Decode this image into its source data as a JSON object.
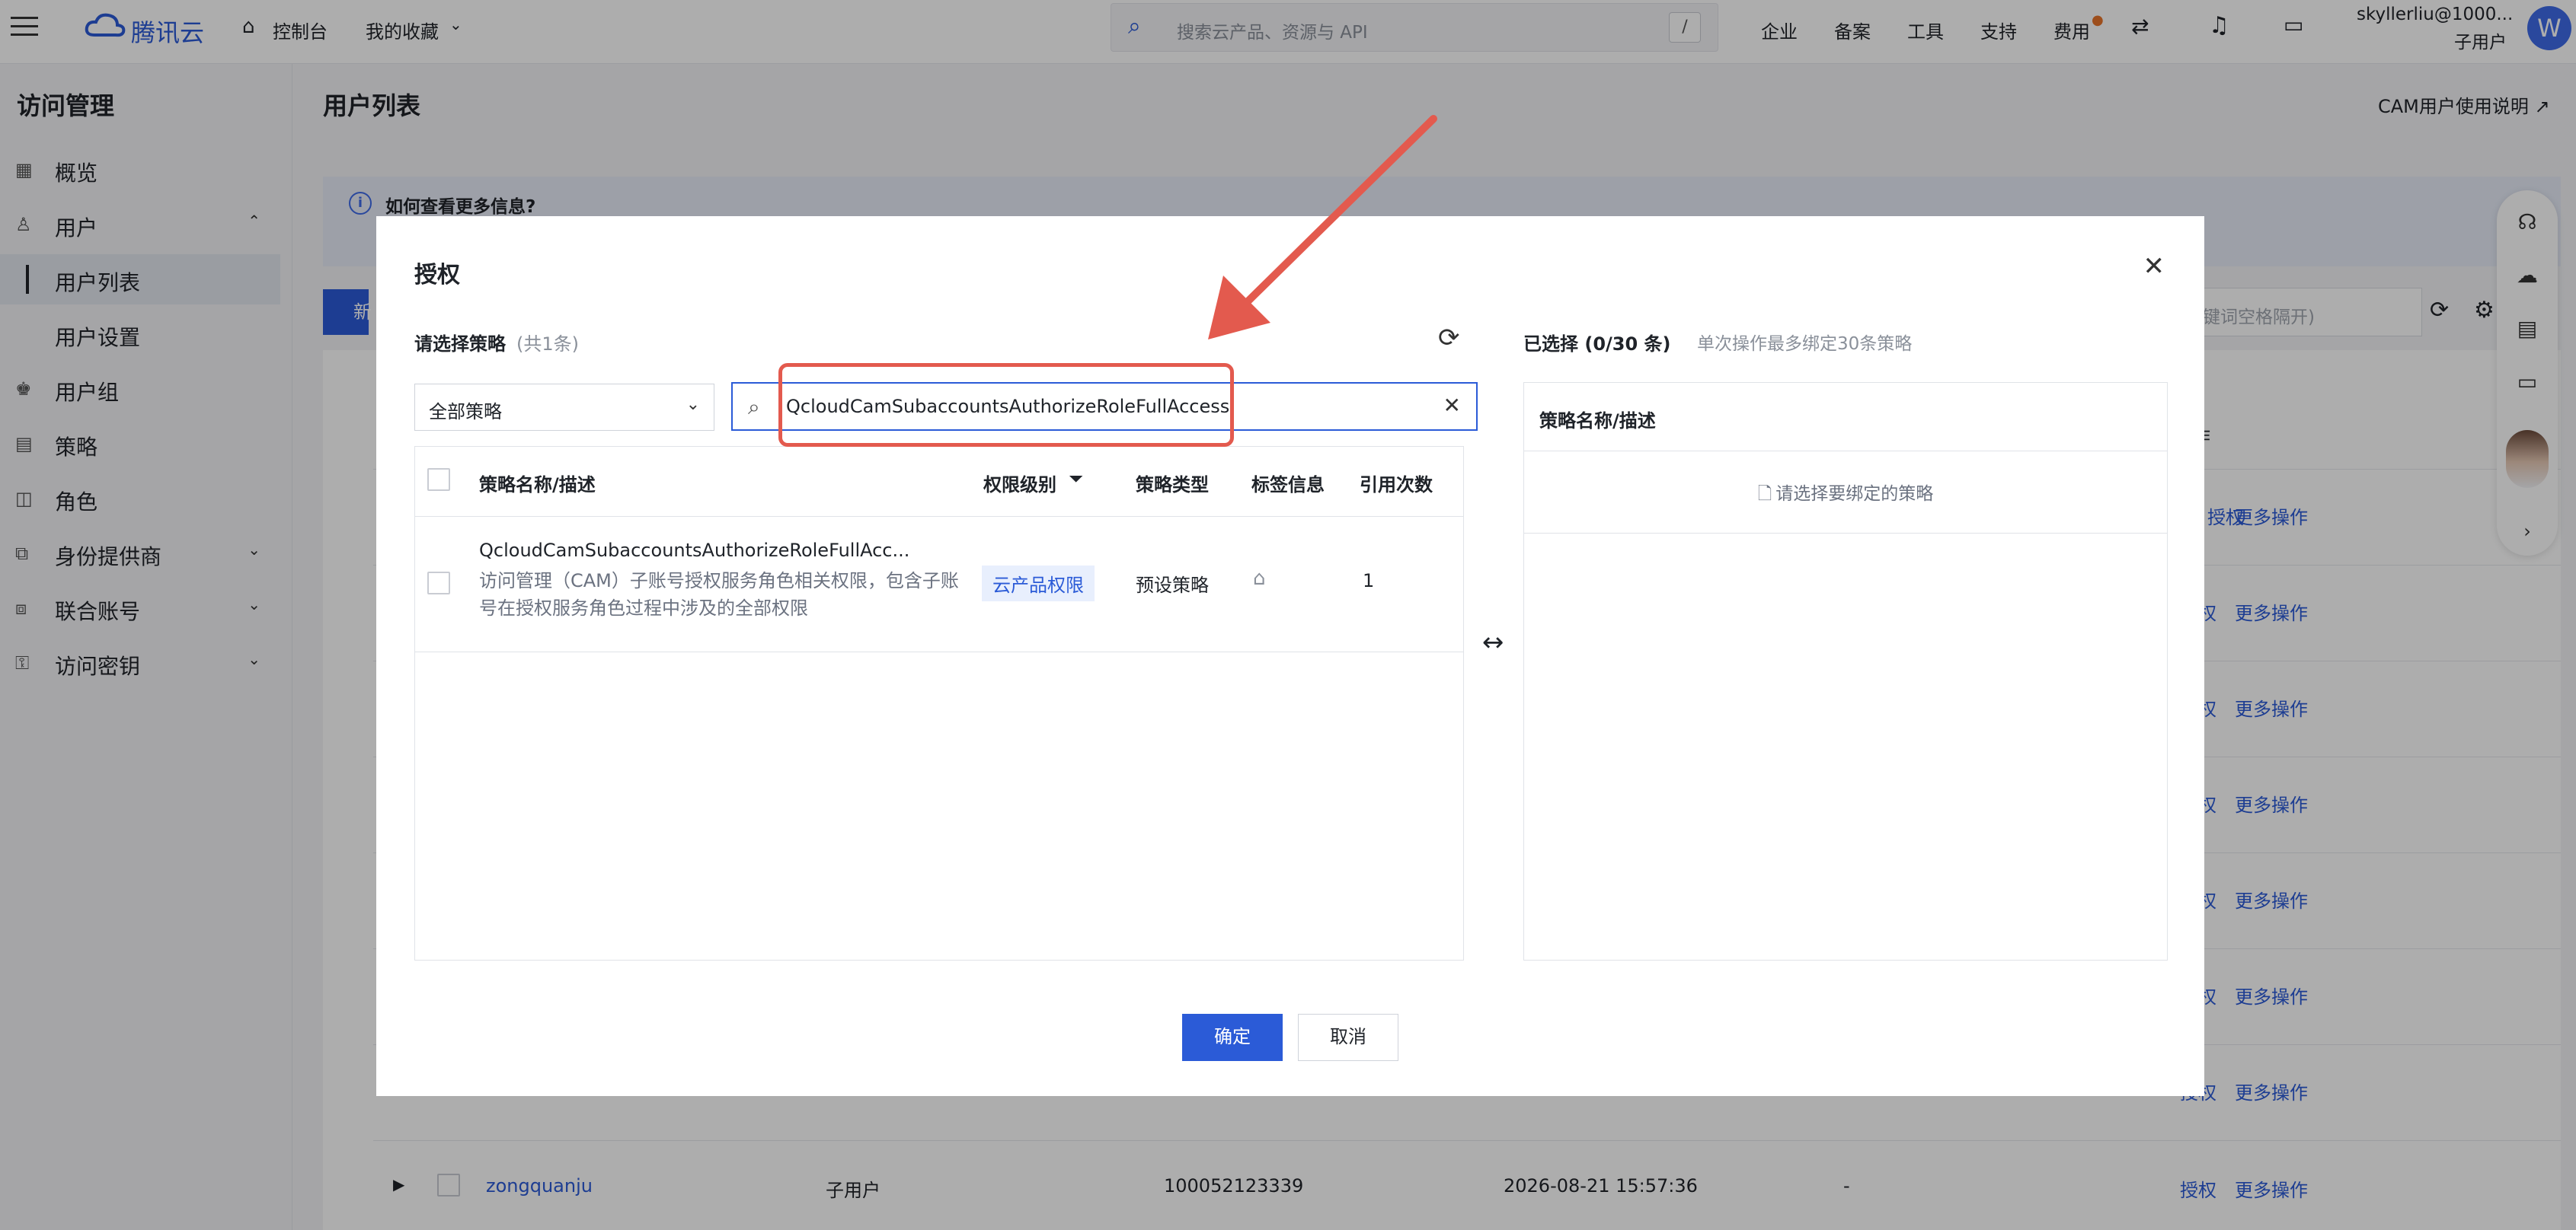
{
  "topbar": {
    "logo": "腾讯云",
    "console": "控制台",
    "favorites": "我的收藏",
    "search_placeholder": "搜索云产品、资源与 API",
    "search_shortcut": "/",
    "links": [
      "企业",
      "备案",
      "工具",
      "支持",
      "费用"
    ],
    "account_name": "skyllerliu@1000...",
    "account_type": "子用户",
    "avatar_letter": "W"
  },
  "sidebar": {
    "title": "访问管理",
    "items": [
      {
        "label": "概览",
        "icon": "overview-icon"
      },
      {
        "label": "用户",
        "icon": "user-icon"
      },
      {
        "label": "用户列表",
        "icon": ""
      },
      {
        "label": "用户设置",
        "icon": ""
      },
      {
        "label": "用户组",
        "icon": "user-group-icon"
      },
      {
        "label": "策略",
        "icon": "policy-icon"
      },
      {
        "label": "角色",
        "icon": "role-icon"
      },
      {
        "label": "身份提供商",
        "icon": "identity-provider-icon"
      },
      {
        "label": "联合账号",
        "icon": "federated-account-icon"
      },
      {
        "label": "访问密钥",
        "icon": "access-key-icon"
      }
    ]
  },
  "page": {
    "title": "用户列表",
    "doc_link": "CAM用户使用说明",
    "info_question": "如何查看更多信息?",
    "new_button": "新",
    "keyword_placeholder": "(多关键词空格隔开)",
    "ops_header": "作",
    "row_actions": {
      "authorize": "授权",
      "more": "更多操作"
    },
    "last_row": {
      "name": "zongquanju",
      "type": "子用户",
      "uin": "100052123339",
      "created": "2026-08-21 15:57:36",
      "extra": "-"
    }
  },
  "modal": {
    "title": "授权",
    "left_label": "请选择策略",
    "left_count": "(共1条)",
    "policy_filter": "全部策略",
    "search_value": "QcloudCamSubaccountsAuthorizeRoleFullAccess",
    "columns": [
      "策略名称/描述",
      "权限级别",
      "策略类型",
      "标签信息",
      "引用次数"
    ],
    "rows": [
      {
        "name": "QcloudCamSubaccountsAuthorizeRoleFullAcc...",
        "description": "访问管理（CAM）子账号授权服务角色相关权限，包含子账号在授权服务角色过程中涉及的全部权限",
        "level": "云产品权限",
        "type": "预设策略",
        "refs": "1"
      }
    ],
    "right_label": "已选择",
    "right_count": "(0/30 条)",
    "right_hint": "单次操作最多绑定30条策略",
    "right_header": "策略名称/描述",
    "right_empty": "请选择要绑定的策略",
    "ok": "确定",
    "cancel": "取消"
  },
  "colors": {
    "primary": "#2b5bd7",
    "annotation": "#e35a4e",
    "level_tag_bg": "#e8effd"
  }
}
